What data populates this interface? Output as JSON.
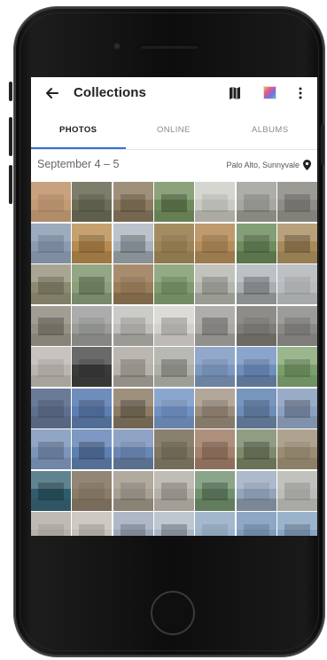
{
  "app": {
    "title": "Collections"
  },
  "toolbar": {
    "icons": [
      "back-arrow-icon",
      "map-icon",
      "color-palette-icon",
      "more-vert-icon"
    ]
  },
  "tabs": [
    {
      "label": "PHOTOS",
      "active": true
    },
    {
      "label": "ONLINE",
      "active": false
    },
    {
      "label": "ALBUMS",
      "active": false
    }
  ],
  "collection": {
    "date_range": "September 4 – 5",
    "location": "Palo Alto, Sunnyvale"
  },
  "colors": {
    "accent": "#2f6fe0",
    "text_primary": "#222222",
    "text_secondary": "#8a8a8a"
  },
  "photo_grid": {
    "columns": 7,
    "thumbnails": [
      [
        "#c49a74",
        "#6c6c58",
        "#8d7b60",
        "#6e8b5a",
        "#c9c9c3",
        "#a7a7a2",
        "#8e8d87"
      ],
      [
        "#8a9bb2",
        "#b88a4c",
        "#a7b1bd",
        "#9d8355",
        "#b58d59",
        "#6c8d5d",
        "#a88a5a"
      ],
      [
        "#8d8a70",
        "#8aa07a",
        "#9c7d5a",
        "#7f9a6e",
        "#b4b5ad",
        "#a8aeb2",
        "#b9bcbe"
      ],
      [
        "#949083",
        "#9b9d9b",
        "#bfbebb",
        "#d3d0cc",
        "#a9a8a4",
        "#807d78",
        "#8a8986"
      ],
      [
        "#b9b6b0",
        "#3b3b3b",
        "#b6b1aa",
        "#aeb0a8",
        "#7c98c0",
        "#6d8fbf",
        "#7aa06a"
      ],
      [
        "#5f6f8f",
        "#5c7eb3",
        "#8b7b65",
        "#6f90c2",
        "#9a8c7a",
        "#6d8db8",
        "#8ca0c0"
      ],
      [
        "#7c94ba",
        "#5d7fb3",
        "#6b86b3",
        "#7f7762",
        "#a3806a",
        "#7d8b6b",
        "#9b8c74"
      ],
      [
        "#2f5d6e",
        "#8b7c6a",
        "#a79f92",
        "#b4b0a8",
        "#6f8f6d",
        "#93a5bd",
        "#bcbcb8"
      ],
      [
        "#b5b2ab",
        "#c4c0b8",
        "#9aa7b9",
        "#aab5c4",
        "#9cb2c8",
        "#7f9bbd",
        "#8aa5c3"
      ]
    ]
  }
}
